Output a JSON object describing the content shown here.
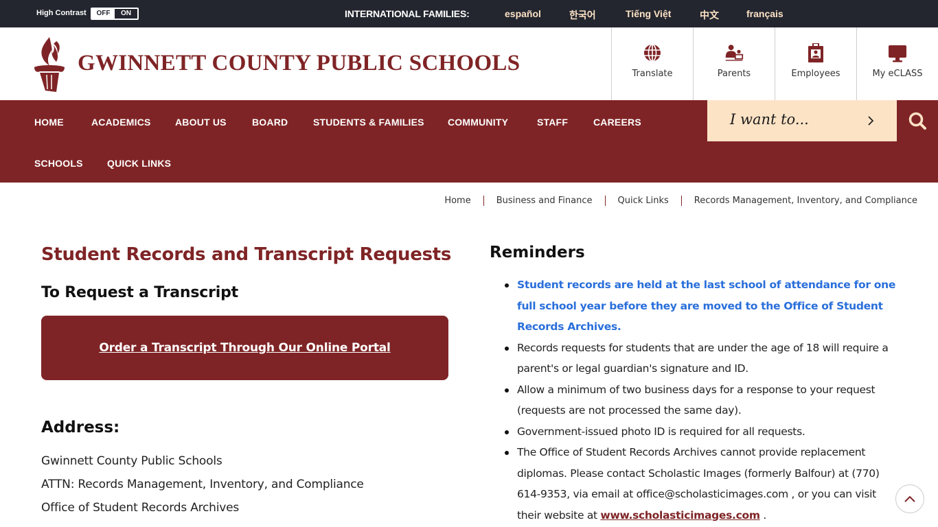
{
  "topbar": {
    "high_contrast_label": "High Contrast",
    "toggle_off": "OFF",
    "toggle_on": "ON",
    "intl_label": "INTERNATIONAL FAMILIES:",
    "languages": [
      "español",
      "한국어",
      "Tiếng Việt",
      "中文",
      "français"
    ]
  },
  "header": {
    "logo_text": "GWINNETT COUNTY PUBLIC SCHOOLS",
    "tiles": [
      {
        "label": "Translate",
        "icon": "globe-icon"
      },
      {
        "label": "Parents",
        "icon": "parents-icon"
      },
      {
        "label": "Employees",
        "icon": "employee-badge-icon"
      },
      {
        "label": "My eCLASS",
        "icon": "monitor-icon"
      }
    ]
  },
  "nav": {
    "items": [
      "HOME",
      "ACADEMICS",
      "ABOUT US",
      "BOARD",
      "STUDENTS & FAMILIES",
      "COMMUNITY",
      "STAFF",
      "CAREERS",
      "SCHOOLS",
      "QUICK LINKS"
    ],
    "i_want_to": "I want to..."
  },
  "breadcrumb": [
    "Home",
    "Business and Finance",
    "Quick Links",
    "Records Management, Inventory, and Compliance"
  ],
  "main": {
    "title": "Student Records and Transcript Requests",
    "subheading": "To Request a Transcript",
    "portal_link": "Order a Transcript Through Our Online Portal",
    "address_heading": "Address:",
    "address_lines": [
      "Gwinnett County Public Schools",
      "ATTN: Records Management, Inventory, and Compliance",
      "Office of Student Records Archives"
    ]
  },
  "reminders": {
    "heading": "Reminders",
    "items": [
      "Student records are held at the last school of attendance for one full school year before they are moved to the Office of Student Records Archives.",
      "Records requests for students that are under the age of 18 will require a parent's or legal guardian's signature and ID.",
      "Allow a minimum of two business days for a response to your request (requests are not processed the same day).",
      "Government-issued photo ID is required for all requests."
    ],
    "last_item_text": "The Office of Student Records Archives cannot provide replacement diplomas. Please contact Scholastic Images (formerly Balfour) at (770) 614-9353, via email at office@scholasticimages.com , or you can visit their website at ",
    "last_item_link": "www.scholasticimages.com",
    "last_item_suffix": " ."
  },
  "colors": {
    "brand_maroon": "#7f2426",
    "topbar_dark": "#23262f",
    "peach": "#fde3c6",
    "highlight_blue": "#2a6fdb"
  }
}
